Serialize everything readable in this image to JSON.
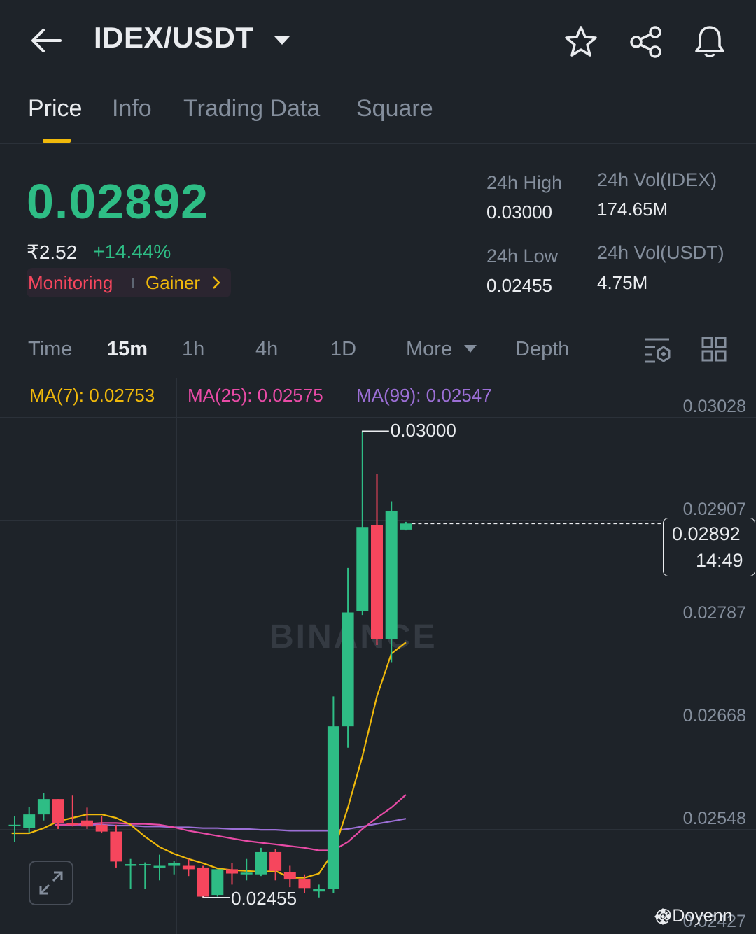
{
  "header": {
    "title": "IDEX/USDT"
  },
  "tabs": [
    {
      "label": "Price"
    },
    {
      "label": "Info"
    },
    {
      "label": "Trading Data"
    },
    {
      "label": "Square"
    }
  ],
  "ticker": {
    "price": "0.02892",
    "fiat_price": "₹2.52",
    "change_pct": "+14.44%",
    "tags": {
      "monitoring": "Monitoring",
      "gainer": "Gainer"
    },
    "high_label": "24h High",
    "high_value": "0.03000",
    "low_label": "24h Low",
    "low_value": "0.02455",
    "vol_base_label": "24h Vol(IDEX)",
    "vol_base_value": "174.65M",
    "vol_quote_label": "24h Vol(USDT)",
    "vol_quote_value": "4.75M"
  },
  "timeframes": [
    {
      "label": "Time"
    },
    {
      "label": "15m"
    },
    {
      "label": "1h"
    },
    {
      "label": "4h"
    },
    {
      "label": "1D"
    },
    {
      "label": "More"
    },
    {
      "label": "Depth"
    }
  ],
  "indicators": {
    "ma7": "MA(7): 0.02753",
    "ma25": "MA(25): 0.02575",
    "ma99": "MA(99): 0.02547"
  },
  "colors": {
    "up": "#2ebd85",
    "down": "#f6465d",
    "accent": "#f0b90b",
    "ma7": "#f0b90b",
    "ma25": "#e84ba6",
    "ma99": "#9c6fd6"
  },
  "chart_data": {
    "type": "candlestick",
    "interval": "15m",
    "y_ticks": [
      "0.03028",
      "0.02907",
      "0.02787",
      "0.02668",
      "0.02548",
      "0.02427"
    ],
    "ylim": [
      0.02427,
      0.03028
    ],
    "current_price": "0.02892",
    "countdown": "14:49",
    "high_marker": "0.03000",
    "low_marker": "0.02455",
    "watermark": "BINANCE",
    "candles": [
      {
        "o": 0.0254,
        "h": 0.0255,
        "l": 0.0252,
        "c": 0.0254
      },
      {
        "o": 0.02536,
        "h": 0.02561,
        "l": 0.0253,
        "c": 0.02552
      },
      {
        "o": 0.02552,
        "h": 0.02577,
        "l": 0.02545,
        "c": 0.0257
      },
      {
        "o": 0.0257,
        "h": 0.0257,
        "l": 0.02535,
        "c": 0.02542
      },
      {
        "o": 0.02542,
        "h": 0.02574,
        "l": 0.02538,
        "c": 0.0254
      },
      {
        "o": 0.02545,
        "h": 0.0256,
        "l": 0.02535,
        "c": 0.02538
      },
      {
        "o": 0.0254,
        "h": 0.0255,
        "l": 0.0253,
        "c": 0.02532
      },
      {
        "o": 0.02532,
        "h": 0.0254,
        "l": 0.0249,
        "c": 0.02497
      },
      {
        "o": 0.02492,
        "h": 0.025,
        "l": 0.02465,
        "c": 0.02494
      },
      {
        "o": 0.02493,
        "h": 0.02496,
        "l": 0.02465,
        "c": 0.02494
      },
      {
        "o": 0.0249,
        "h": 0.02505,
        "l": 0.02475,
        "c": 0.02492
      },
      {
        "o": 0.02492,
        "h": 0.02498,
        "l": 0.02482,
        "c": 0.02495
      },
      {
        "o": 0.02492,
        "h": 0.025,
        "l": 0.0248,
        "c": 0.02488
      },
      {
        "o": 0.0249,
        "h": 0.02492,
        "l": 0.02455,
        "c": 0.02456
      },
      {
        "o": 0.02458,
        "h": 0.02488,
        "l": 0.02456,
        "c": 0.02488
      },
      {
        "o": 0.02488,
        "h": 0.02495,
        "l": 0.0247,
        "c": 0.02483
      },
      {
        "o": 0.02482,
        "h": 0.025,
        "l": 0.02475,
        "c": 0.02484
      },
      {
        "o": 0.02482,
        "h": 0.02513,
        "l": 0.0248,
        "c": 0.02508
      },
      {
        "o": 0.02508,
        "h": 0.02512,
        "l": 0.02475,
        "c": 0.02486
      },
      {
        "o": 0.02485,
        "h": 0.02492,
        "l": 0.02467,
        "c": 0.02476
      },
      {
        "o": 0.02476,
        "h": 0.02482,
        "l": 0.0246,
        "c": 0.02466
      },
      {
        "o": 0.02462,
        "h": 0.0247,
        "l": 0.02455,
        "c": 0.02465
      },
      {
        "o": 0.02465,
        "h": 0.0269,
        "l": 0.0246,
        "c": 0.02655
      },
      {
        "o": 0.02655,
        "h": 0.0284,
        "l": 0.0263,
        "c": 0.02788
      },
      {
        "o": 0.0279,
        "h": 0.03,
        "l": 0.02785,
        "c": 0.02888
      },
      {
        "o": 0.0289,
        "h": 0.0295,
        "l": 0.0275,
        "c": 0.02757
      },
      {
        "o": 0.02757,
        "h": 0.02918,
        "l": 0.0273,
        "c": 0.02907
      },
      {
        "o": 0.02885,
        "h": 0.02894,
        "l": 0.02884,
        "c": 0.02892
      }
    ],
    "ma7": [
      0.0253,
      0.02536,
      0.02544,
      0.02548,
      0.02552,
      0.02552,
      0.02548,
      0.0254,
      0.02526,
      0.02514,
      0.02506,
      0.025,
      0.02495,
      0.02489,
      0.02487,
      0.02486,
      0.02485,
      0.02486,
      0.02478,
      0.02478,
      0.02483,
      0.02508,
      0.0256,
      0.0262,
      0.0269,
      0.0274,
      0.02753
    ],
    "ma25": [
      0.0254,
      0.02541,
      0.02542,
      0.02542,
      0.02541,
      0.02541,
      0.0254,
      0.02537,
      0.02533,
      0.0253,
      0.02527,
      0.02524,
      0.02521,
      0.02519,
      0.02517,
      0.02515,
      0.02513,
      0.0251,
      0.0251,
      0.0252,
      0.02535,
      0.02548,
      0.0256,
      0.02575
    ],
    "ma99": [
      0.0254,
      0.0254,
      0.0254,
      0.02539,
      0.02539,
      0.02538,
      0.02538,
      0.02537,
      0.02537,
      0.02536,
      0.02536,
      0.02535,
      0.02535,
      0.02534,
      0.02534,
      0.02533,
      0.02533,
      0.02533,
      0.02533,
      0.02535,
      0.02538,
      0.02541,
      0.02544,
      0.02547
    ]
  },
  "footer": {
    "credit": "@Doyenn"
  }
}
